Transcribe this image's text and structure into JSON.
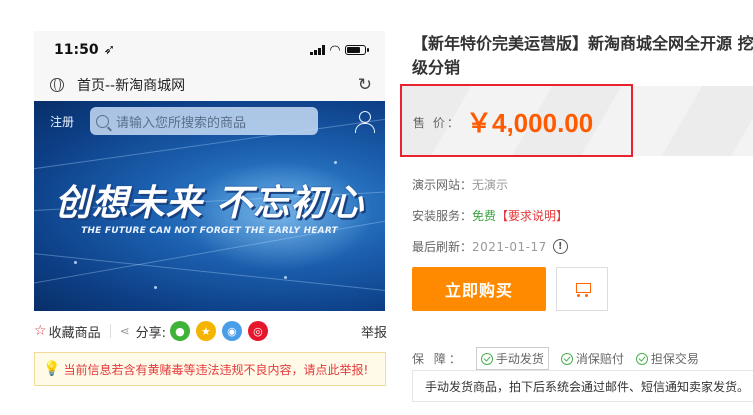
{
  "product_image": {
    "status_bar": {
      "time": "11:50 ➶"
    },
    "address_bar": {
      "title": "首页--新淘商城网"
    },
    "banner": {
      "register": "注册",
      "search_placeholder": "请输入您所搜索的商品",
      "headline": "创想未来  不忘初心",
      "tagline": "THE FUTURE CAN NOT FORGET THE EARLY HEART"
    }
  },
  "actions": {
    "favorite_label": "收藏商品",
    "share_label": "分享:",
    "report_label": "举报",
    "share_targets": [
      {
        "name": "wechat",
        "color": "#3fb337",
        "glyph": "●"
      },
      {
        "name": "qzone",
        "color": "#f5b400",
        "glyph": "★"
      },
      {
        "name": "qq",
        "color": "#4a9ee8",
        "glyph": "◉"
      },
      {
        "name": "weibo",
        "color": "#e6162d",
        "glyph": "◎"
      }
    ]
  },
  "notice": {
    "text": "当前信息若含有黄赌毒等违法违规不良内容，请点此举报!"
  },
  "product": {
    "title": "【新年特价完美运营版】新淘商城全网全开源 挖级分销",
    "price_label": "售 价：",
    "price": "￥4,000.00",
    "demo_site_label": "演示网站：",
    "demo_site_value": "无演示",
    "install_label": "安装服务：",
    "install_value": "免费",
    "install_req": "【要求说明】",
    "refresh_label": "最后刷新：",
    "refresh_date": "2021-01-17",
    "buy_label": "立即购买",
    "guarantee_label": "保 障：",
    "guarantees": [
      "手动发货",
      "消保赔付",
      "担保交易"
    ],
    "guarantee_desc": "手动发货商品，拍下后系统会通过邮件、短信通知卖家发货。"
  },
  "colors": {
    "accent": "#ff8a00",
    "price": "#ff5a00",
    "highlight_frame": "#e8232d"
  }
}
